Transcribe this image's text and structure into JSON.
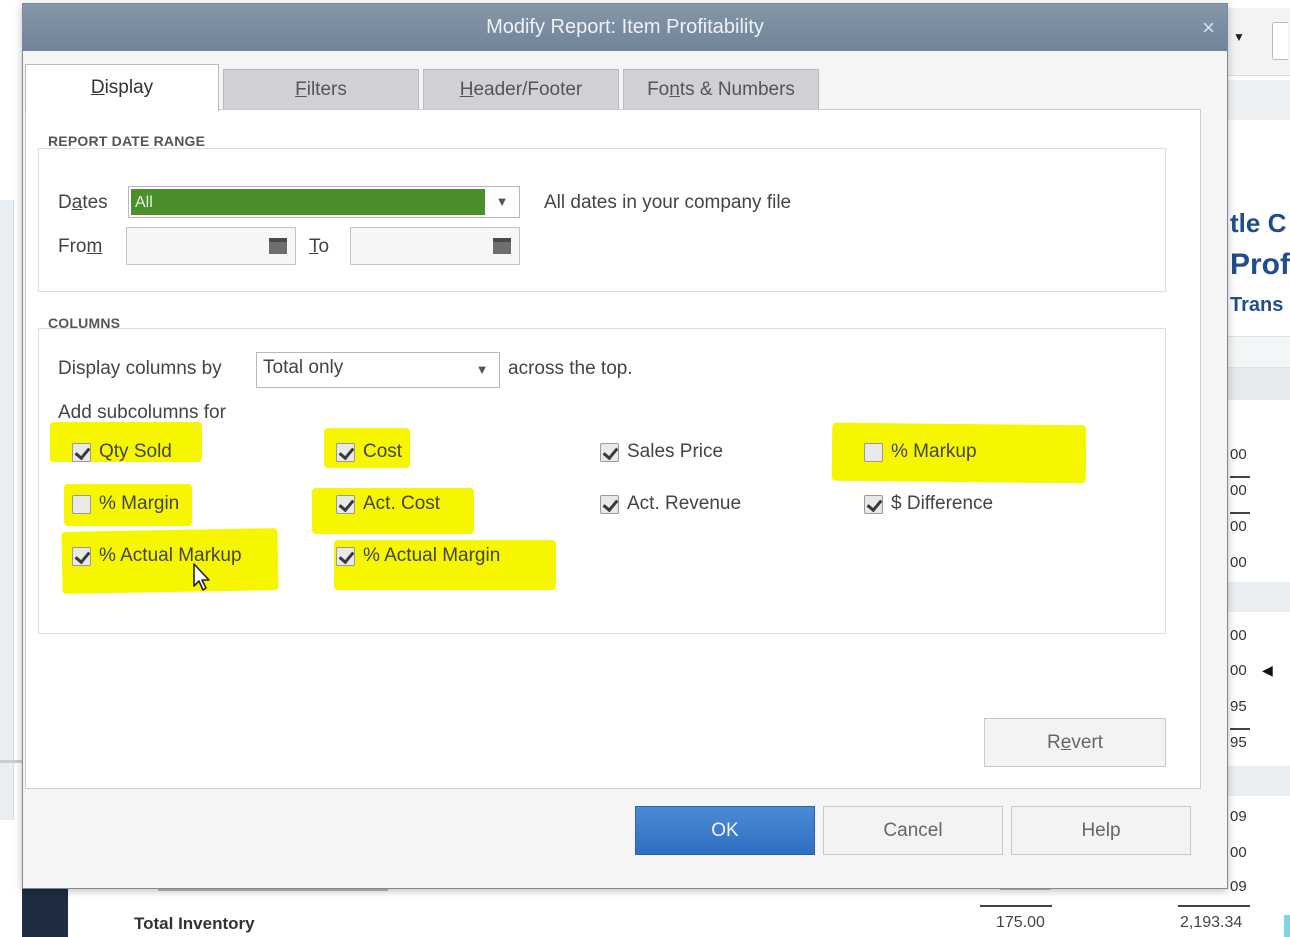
{
  "dialog": {
    "title": "Modify Report: Item Profitability",
    "close_glyph": "×"
  },
  "tabs": [
    {
      "label": "Display",
      "mnemonic": "D",
      "rest": "isplay"
    },
    {
      "label": "Filters",
      "mnemonic": "F",
      "rest": "ilters"
    },
    {
      "label": "Header/Footer",
      "mnemonic": "H",
      "rest": "eader/Footer"
    },
    {
      "label": "Fonts & Numbers",
      "pre": "Fo",
      "mnemonic": "n",
      "rest": "ts & Numbers"
    }
  ],
  "date_range": {
    "group_label": "REPORT DATE RANGE",
    "dates_label_pre": "D",
    "dates_label_mn": "a",
    "dates_label_post": "tes",
    "dates_value": "All",
    "dates_description": "All dates in your company file",
    "from_label_pre": "Fro",
    "from_label_mn": "m",
    "to_label_mn": "T",
    "to_label_post": "o"
  },
  "columns": {
    "group_label": "COLUMNS",
    "display_by_label": "Display columns by",
    "display_by_value": "Total only",
    "across_text": "across the top.",
    "subcolumns_label": "Add subcolumns for",
    "items": [
      {
        "label": "Qty Sold",
        "checked": true
      },
      {
        "label": "Cost",
        "checked": true
      },
      {
        "label": "Sales Price",
        "checked": true
      },
      {
        "label": "% Markup",
        "checked": false
      },
      {
        "label": "% Margin",
        "checked": false
      },
      {
        "label": "Act. Cost",
        "checked": true
      },
      {
        "label": "Act. Revenue",
        "checked": true
      },
      {
        "label": "$ Difference",
        "checked": true
      },
      {
        "label": "% Actual Markup",
        "checked": true
      },
      {
        "label": "% Actual Margin",
        "checked": true
      }
    ]
  },
  "buttons": {
    "revert_pre": "R",
    "revert_mn": "e",
    "revert_post": "vert",
    "ok": "OK",
    "cancel": "Cancel",
    "help": "Help"
  },
  "colors": {
    "accent_blue": "#3a7bcf",
    "highlight_yellow": "#f6f600",
    "dates_selected_green": "#4b8f2a",
    "titlebar": "#7a8da1"
  },
  "background_report": {
    "title_fragments": [
      "tle C",
      "Prof",
      "Trans"
    ],
    "col_values": [
      "00",
      "00",
      "00",
      "00",
      "00",
      "00",
      "95",
      "95",
      "09",
      "00",
      "09"
    ],
    "total_label": "Total Inventory",
    "total_qty": "175.00",
    "total_amount": "2,193.34"
  }
}
